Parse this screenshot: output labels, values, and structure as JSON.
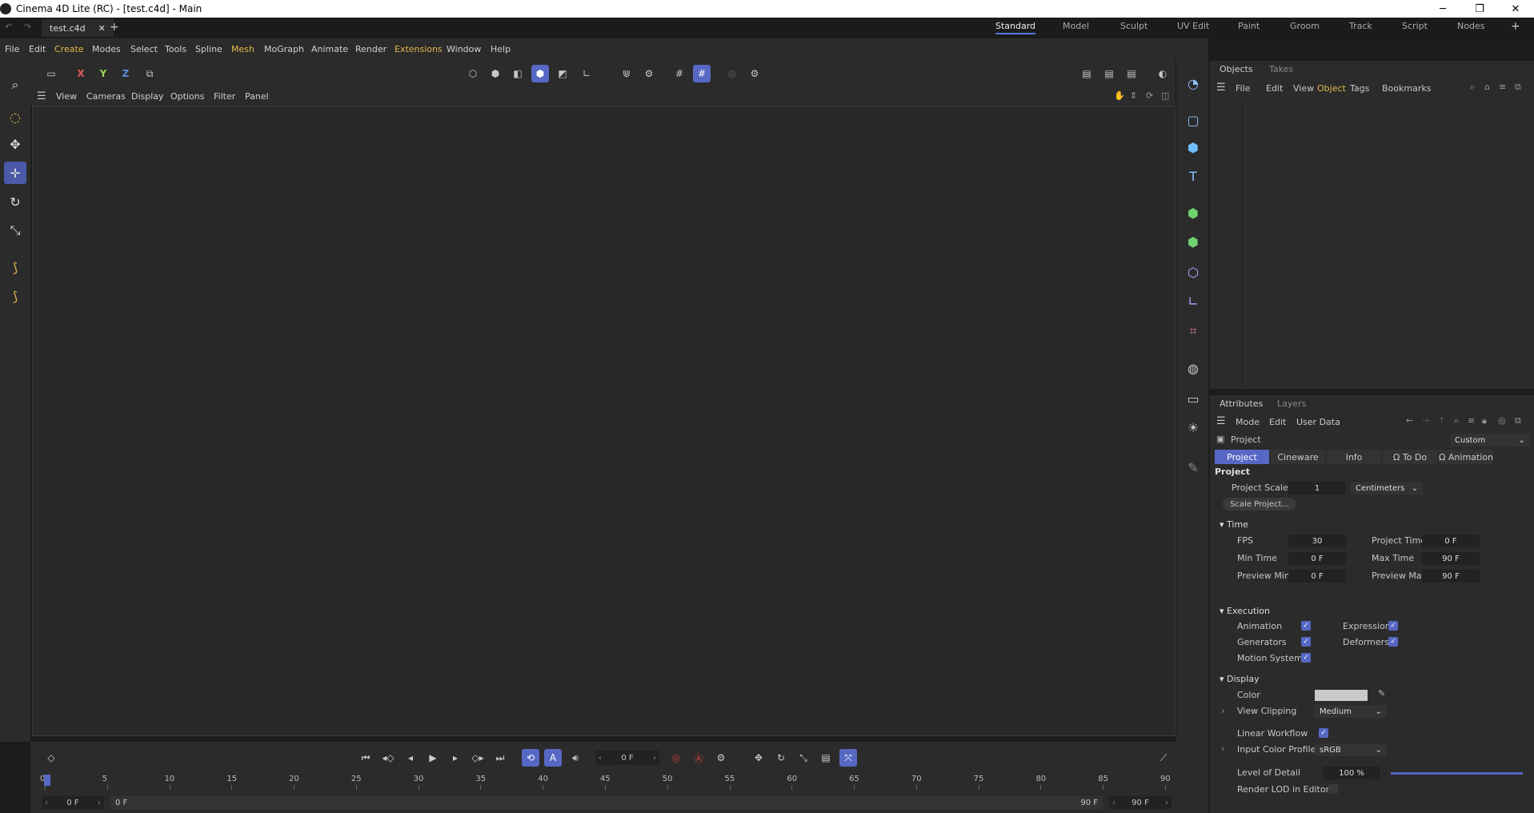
{
  "window": {
    "title": "Cinema 4D Lite (RC) - [test.c4d] - Main",
    "min": "─",
    "max": "❐",
    "close": "✕"
  },
  "tabs": {
    "doc": "test.c4d",
    "close": "✕",
    "add": "+"
  },
  "layouts": [
    "Standard",
    "Model",
    "Sculpt",
    "UV Edit",
    "Paint",
    "Groom",
    "Track",
    "Script",
    "Nodes"
  ],
  "menu": [
    "File",
    "Edit",
    "Create",
    "Modes",
    "Select",
    "Tools",
    "Spline",
    "Mesh",
    "MoGraph",
    "Animate",
    "Render",
    "Extensions",
    "Window",
    "Help"
  ],
  "axes": {
    "x": "X",
    "y": "Y",
    "z": "Z"
  },
  "viewport_menu": [
    "View",
    "Cameras",
    "Display",
    "Options",
    "Filter",
    "Panel"
  ],
  "objects_panel": {
    "tabs": [
      "Objects",
      "Takes"
    ],
    "menu": [
      "File",
      "Edit",
      "View",
      "Object",
      "Tags",
      "Bookmarks"
    ]
  },
  "attributes": {
    "tabs": [
      "Attributes",
      "Layers"
    ],
    "menu": [
      "Mode",
      "Edit",
      "User Data"
    ],
    "object_label": "Project",
    "preset": "Custom",
    "subtabs": [
      "Project",
      "Cineware",
      "Info",
      "To Do",
      "Animation"
    ],
    "section_title": "Project",
    "project_scale_label": "Project Scale",
    "project_scale_value": "1",
    "project_scale_unit": "Centimeters",
    "scale_button": "Scale Project...",
    "time": {
      "title": "Time",
      "fps_label": "FPS",
      "fps": "30",
      "project_time_label": "Project Time",
      "project_time": "0 F",
      "min_time_label": "Min Time",
      "min_time": "0 F",
      "max_time_label": "Max Time",
      "max_time": "90 F",
      "preview_min_label": "Preview Min",
      "preview_min": "0 F",
      "preview_max_label": "Preview Max",
      "preview_max": "90 F"
    },
    "execution": {
      "title": "Execution",
      "animation": "Animation",
      "expression": "Expression",
      "generators": "Generators",
      "deformers": "Deformers",
      "motion_system": "Motion System"
    },
    "display": {
      "title": "Display",
      "color_label": "Color",
      "color_value": "#c9c9c9",
      "view_clipping_label": "View Clipping",
      "view_clipping": "Medium",
      "linear_workflow_label": "Linear Workflow",
      "input_color_profile_label": "Input Color Profile",
      "input_color_profile": "sRGB",
      "level_of_detail_label": "Level of Detail",
      "level_of_detail": "100 %",
      "render_lod_label": "Render LOD in Editor"
    }
  },
  "timeline": {
    "current_frame": "0 F",
    "ticks": [
      "0",
      "5",
      "10",
      "15",
      "20",
      "25",
      "30",
      "35",
      "40",
      "45",
      "50",
      "55",
      "60",
      "65",
      "70",
      "75",
      "80",
      "85",
      "90"
    ],
    "start": "0 F",
    "range_start": "0 F",
    "range_end": "90 F",
    "end": "90 F"
  },
  "colors": {
    "accent": "#5767c4",
    "highlight_menu": "#e0b94b",
    "background": "#2b2b2b"
  }
}
